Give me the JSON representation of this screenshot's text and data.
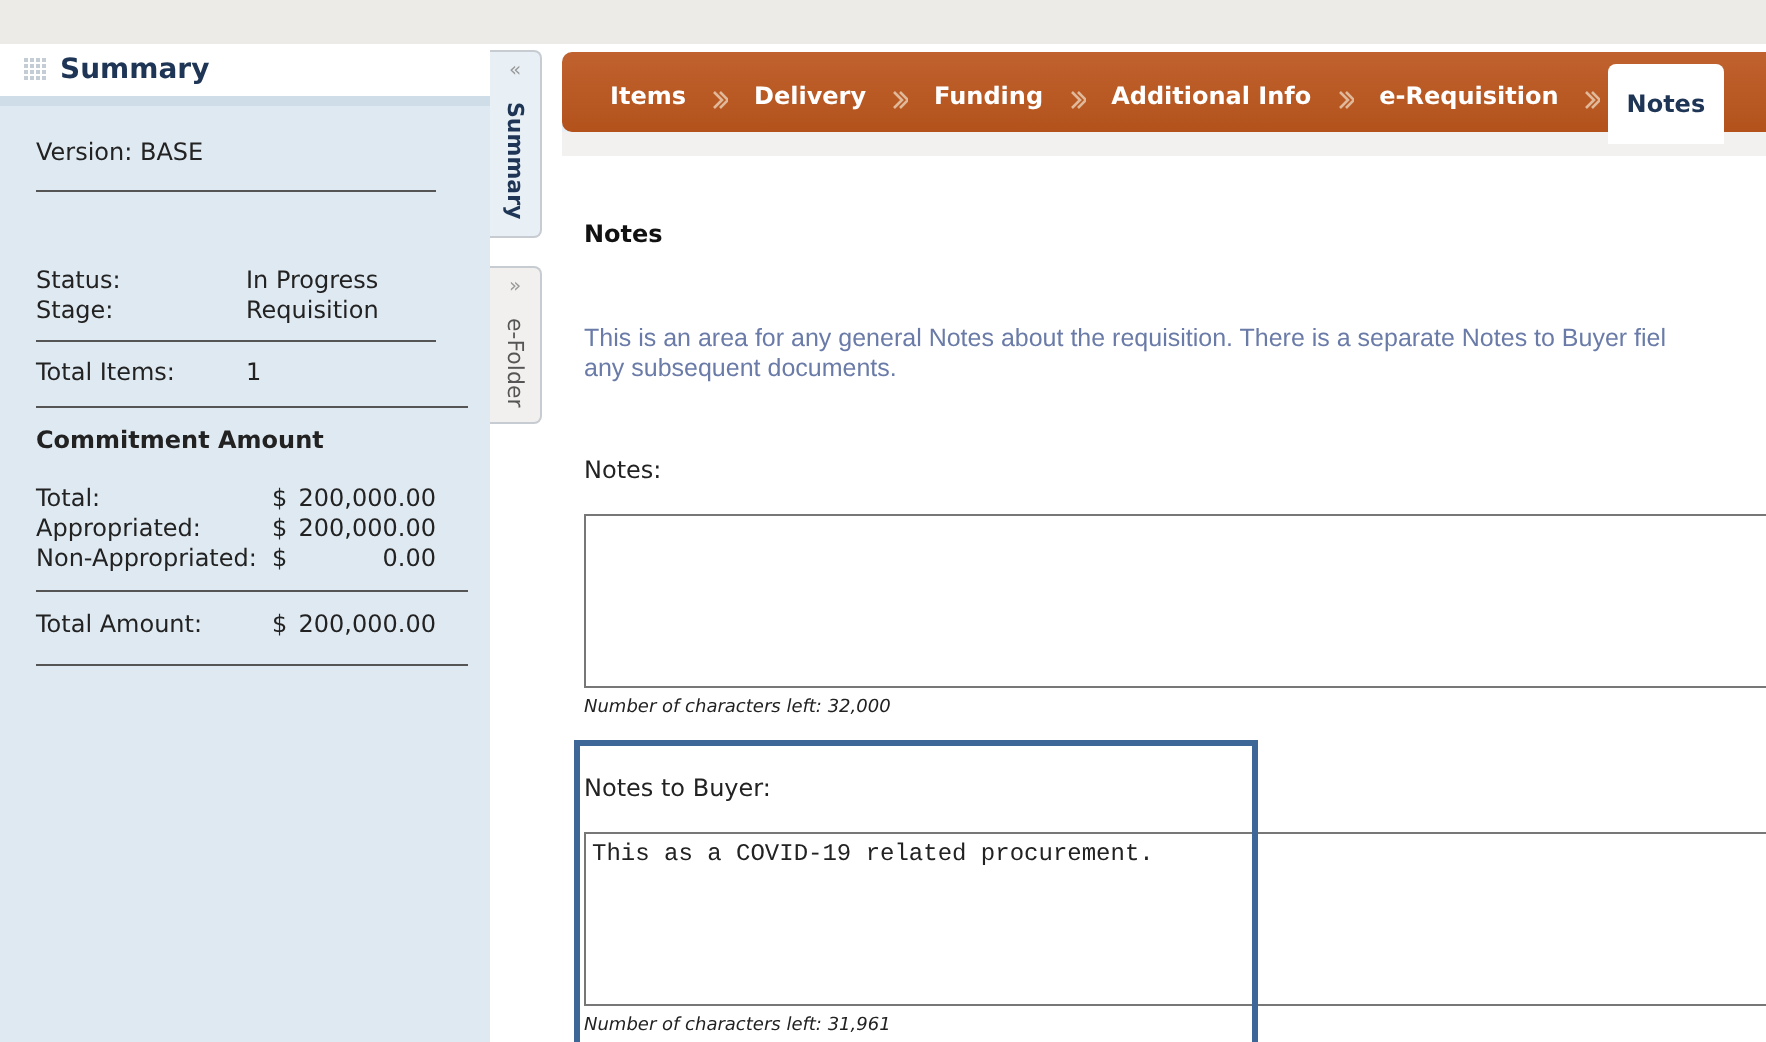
{
  "summary": {
    "title": "Summary",
    "version": "Version: BASE",
    "status_rows": [
      {
        "label": "Status:",
        "value": "In Progress"
      },
      {
        "label": "Stage:",
        "value": "Requisition"
      }
    ],
    "items_row": {
      "label": "Total Items:",
      "value": "1"
    },
    "commitment": {
      "heading": "Commitment Amount",
      "rows": [
        {
          "label": "Total:",
          "currency": "$",
          "value": "200,000.00"
        },
        {
          "label": "Appropriated:",
          "currency": "$",
          "value": "200,000.00"
        },
        {
          "label": "Non-Appropriated:",
          "currency": "$",
          "value": "0.00"
        }
      ]
    },
    "total_row": {
      "label": "Total Amount:",
      "currency": "$",
      "value": "200,000.00"
    }
  },
  "side_tabs": [
    {
      "label": "Summary",
      "arrow": "«",
      "selected": true
    },
    {
      "label": "e-Folder",
      "arrow": "»",
      "selected": false
    }
  ],
  "breadcrumb": [
    {
      "label": "Items",
      "selected": false
    },
    {
      "label": "Delivery",
      "selected": false
    },
    {
      "label": "Funding",
      "selected": false
    },
    {
      "label": "Additional Info",
      "selected": false
    },
    {
      "label": "e-Requisition",
      "selected": false
    },
    {
      "label": "Notes",
      "selected": true
    }
  ],
  "notes": {
    "heading": "Notes",
    "description_lines": [
      "This is an area for any general Notes about the requisition. There is a separate Notes to Buyer fiel",
      "any subsequent documents."
    ],
    "fields": [
      {
        "label": "Notes:",
        "counter": "Number of characters left: 32,000",
        "highlighted": false
      },
      {
        "label": "Notes to Buyer:",
        "value": "This as a COVID-19 related procurement.",
        "counter": "Number of characters left: 31,961",
        "highlighted": true
      }
    ]
  }
}
